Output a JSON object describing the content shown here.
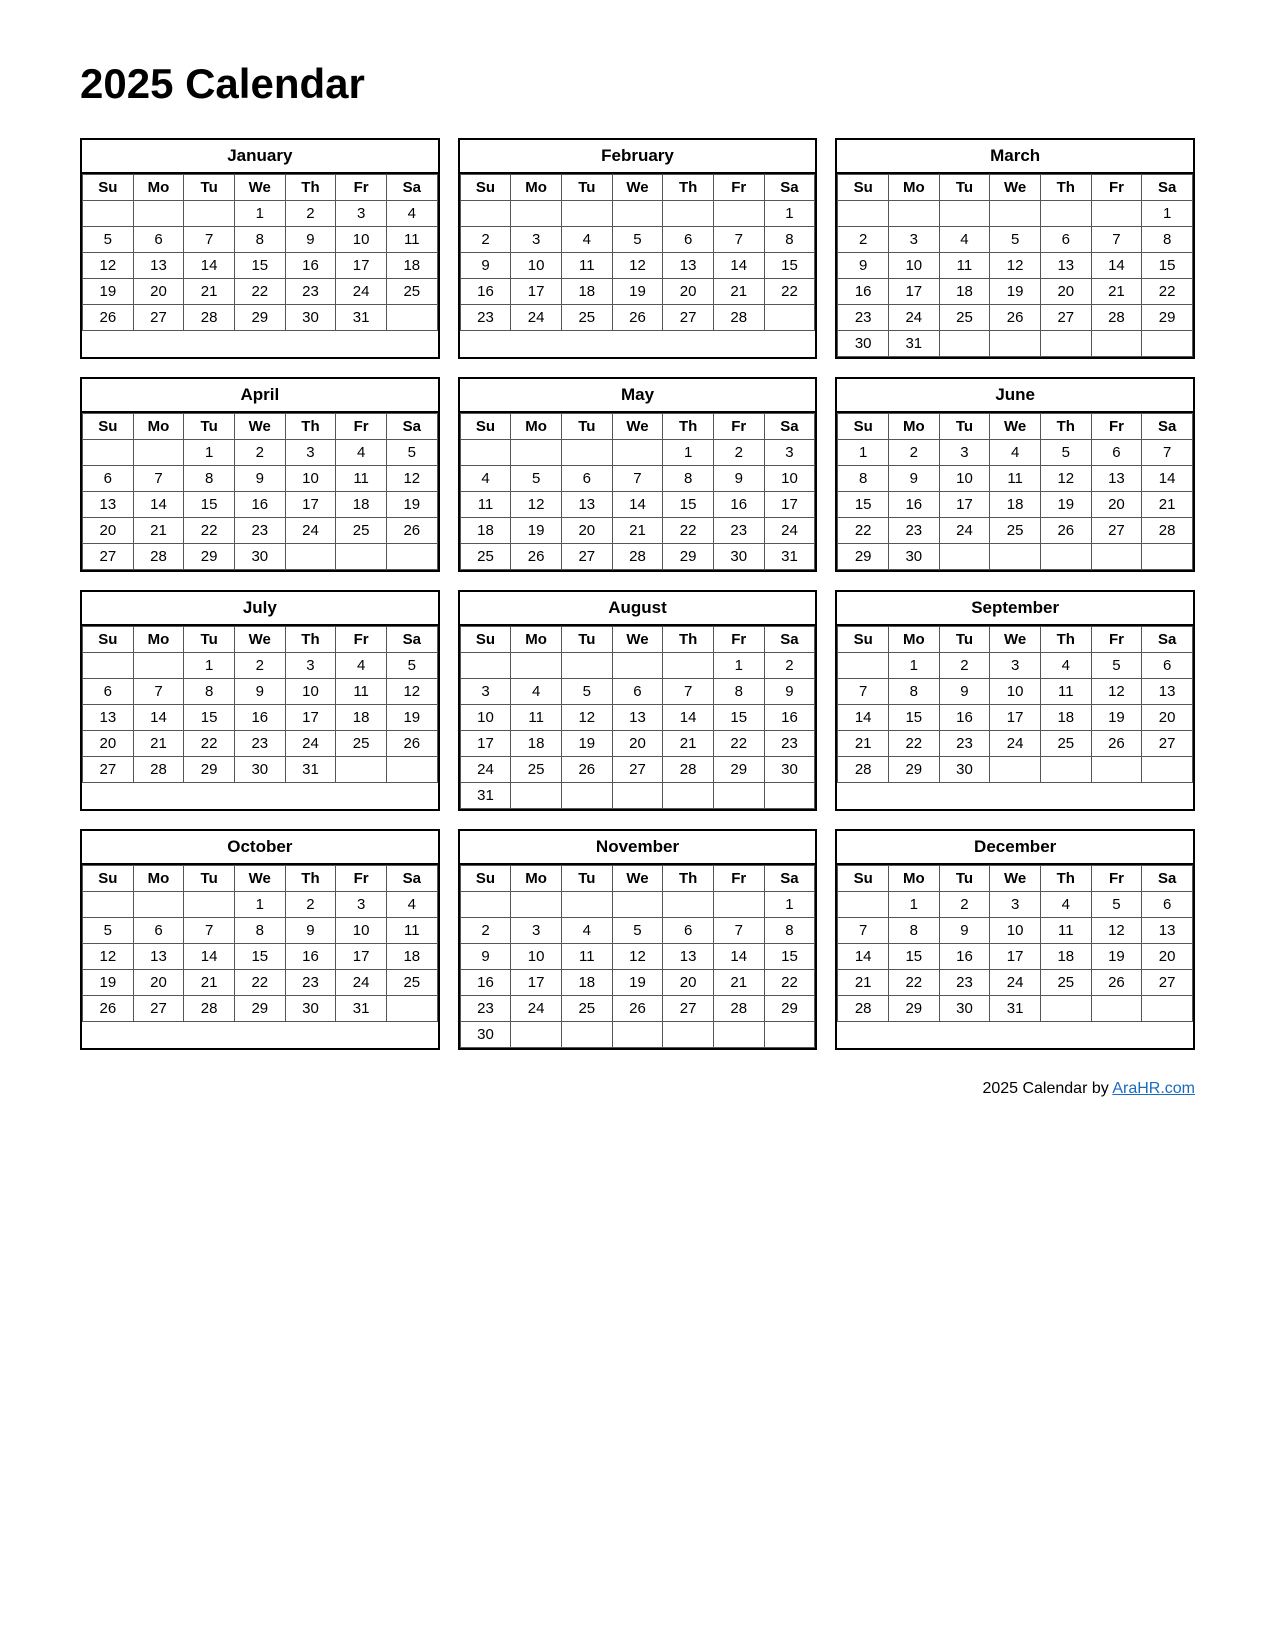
{
  "title": "2025 Calendar",
  "footer": {
    "text": "2025  Calendar by ",
    "link_text": "AraHR.com",
    "link_url": "#"
  },
  "months": [
    {
      "name": "January",
      "days_header": [
        "Su",
        "Mo",
        "Tu",
        "We",
        "Th",
        "Fr",
        "Sa"
      ],
      "weeks": [
        [
          "",
          "",
          "",
          "1",
          "2",
          "3",
          "4"
        ],
        [
          "5",
          "6",
          "7",
          "8",
          "9",
          "10",
          "11"
        ],
        [
          "12",
          "13",
          "14",
          "15",
          "16",
          "17",
          "18"
        ],
        [
          "19",
          "20",
          "21",
          "22",
          "23",
          "24",
          "25"
        ],
        [
          "26",
          "27",
          "28",
          "29",
          "30",
          "31",
          ""
        ]
      ]
    },
    {
      "name": "February",
      "days_header": [
        "Su",
        "Mo",
        "Tu",
        "We",
        "Th",
        "Fr",
        "Sa"
      ],
      "weeks": [
        [
          "",
          "",
          "",
          "",
          "",
          "",
          "1"
        ],
        [
          "2",
          "3",
          "4",
          "5",
          "6",
          "7",
          "8"
        ],
        [
          "9",
          "10",
          "11",
          "12",
          "13",
          "14",
          "15"
        ],
        [
          "16",
          "17",
          "18",
          "19",
          "20",
          "21",
          "22"
        ],
        [
          "23",
          "24",
          "25",
          "26",
          "27",
          "28",
          ""
        ]
      ]
    },
    {
      "name": "March",
      "days_header": [
        "Su",
        "Mo",
        "Tu",
        "We",
        "Th",
        "Fr",
        "Sa"
      ],
      "weeks": [
        [
          "",
          "",
          "",
          "",
          "",
          "",
          "1"
        ],
        [
          "2",
          "3",
          "4",
          "5",
          "6",
          "7",
          "8"
        ],
        [
          "9",
          "10",
          "11",
          "12",
          "13",
          "14",
          "15"
        ],
        [
          "16",
          "17",
          "18",
          "19",
          "20",
          "21",
          "22"
        ],
        [
          "23",
          "24",
          "25",
          "26",
          "27",
          "28",
          "29"
        ],
        [
          "30",
          "31",
          "",
          "",
          "",
          "",
          ""
        ]
      ]
    },
    {
      "name": "April",
      "days_header": [
        "Su",
        "Mo",
        "Tu",
        "We",
        "Th",
        "Fr",
        "Sa"
      ],
      "weeks": [
        [
          "",
          "",
          "1",
          "2",
          "3",
          "4",
          "5"
        ],
        [
          "6",
          "7",
          "8",
          "9",
          "10",
          "11",
          "12"
        ],
        [
          "13",
          "14",
          "15",
          "16",
          "17",
          "18",
          "19"
        ],
        [
          "20",
          "21",
          "22",
          "23",
          "24",
          "25",
          "26"
        ],
        [
          "27",
          "28",
          "29",
          "30",
          "",
          "",
          ""
        ]
      ]
    },
    {
      "name": "May",
      "days_header": [
        "Su",
        "Mo",
        "Tu",
        "We",
        "Th",
        "Fr",
        "Sa"
      ],
      "weeks": [
        [
          "",
          "",
          "",
          "",
          "1",
          "2",
          "3"
        ],
        [
          "4",
          "5",
          "6",
          "7",
          "8",
          "9",
          "10"
        ],
        [
          "11",
          "12",
          "13",
          "14",
          "15",
          "16",
          "17"
        ],
        [
          "18",
          "19",
          "20",
          "21",
          "22",
          "23",
          "24"
        ],
        [
          "25",
          "26",
          "27",
          "28",
          "29",
          "30",
          "31"
        ]
      ]
    },
    {
      "name": "June",
      "days_header": [
        "Su",
        "Mo",
        "Tu",
        "We",
        "Th",
        "Fr",
        "Sa"
      ],
      "weeks": [
        [
          "1",
          "2",
          "3",
          "4",
          "5",
          "6",
          "7"
        ],
        [
          "8",
          "9",
          "10",
          "11",
          "12",
          "13",
          "14"
        ],
        [
          "15",
          "16",
          "17",
          "18",
          "19",
          "20",
          "21"
        ],
        [
          "22",
          "23",
          "24",
          "25",
          "26",
          "27",
          "28"
        ],
        [
          "29",
          "30",
          "",
          "",
          "",
          "",
          ""
        ]
      ]
    },
    {
      "name": "July",
      "days_header": [
        "Su",
        "Mo",
        "Tu",
        "We",
        "Th",
        "Fr",
        "Sa"
      ],
      "weeks": [
        [
          "",
          "",
          "1",
          "2",
          "3",
          "4",
          "5"
        ],
        [
          "6",
          "7",
          "8",
          "9",
          "10",
          "11",
          "12"
        ],
        [
          "13",
          "14",
          "15",
          "16",
          "17",
          "18",
          "19"
        ],
        [
          "20",
          "21",
          "22",
          "23",
          "24",
          "25",
          "26"
        ],
        [
          "27",
          "28",
          "29",
          "30",
          "31",
          "",
          ""
        ]
      ]
    },
    {
      "name": "August",
      "days_header": [
        "Su",
        "Mo",
        "Tu",
        "We",
        "Th",
        "Fr",
        "Sa"
      ],
      "weeks": [
        [
          "",
          "",
          "",
          "",
          "",
          "1",
          "2"
        ],
        [
          "3",
          "4",
          "5",
          "6",
          "7",
          "8",
          "9"
        ],
        [
          "10",
          "11",
          "12",
          "13",
          "14",
          "15",
          "16"
        ],
        [
          "17",
          "18",
          "19",
          "20",
          "21",
          "22",
          "23"
        ],
        [
          "24",
          "25",
          "26",
          "27",
          "28",
          "29",
          "30"
        ],
        [
          "31",
          "",
          "",
          "",
          "",
          "",
          ""
        ]
      ]
    },
    {
      "name": "September",
      "days_header": [
        "Su",
        "Mo",
        "Tu",
        "We",
        "Th",
        "Fr",
        "Sa"
      ],
      "weeks": [
        [
          "",
          "1",
          "2",
          "3",
          "4",
          "5",
          "6"
        ],
        [
          "7",
          "8",
          "9",
          "10",
          "11",
          "12",
          "13"
        ],
        [
          "14",
          "15",
          "16",
          "17",
          "18",
          "19",
          "20"
        ],
        [
          "21",
          "22",
          "23",
          "24",
          "25",
          "26",
          "27"
        ],
        [
          "28",
          "29",
          "30",
          "",
          "",
          "",
          ""
        ]
      ]
    },
    {
      "name": "October",
      "days_header": [
        "Su",
        "Mo",
        "Tu",
        "We",
        "Th",
        "Fr",
        "Sa"
      ],
      "weeks": [
        [
          "",
          "",
          "",
          "1",
          "2",
          "3",
          "4"
        ],
        [
          "5",
          "6",
          "7",
          "8",
          "9",
          "10",
          "11"
        ],
        [
          "12",
          "13",
          "14",
          "15",
          "16",
          "17",
          "18"
        ],
        [
          "19",
          "20",
          "21",
          "22",
          "23",
          "24",
          "25"
        ],
        [
          "26",
          "27",
          "28",
          "29",
          "30",
          "31",
          ""
        ]
      ]
    },
    {
      "name": "November",
      "days_header": [
        "Su",
        "Mo",
        "Tu",
        "We",
        "Th",
        "Fr",
        "Sa"
      ],
      "weeks": [
        [
          "",
          "",
          "",
          "",
          "",
          "",
          "1"
        ],
        [
          "2",
          "3",
          "4",
          "5",
          "6",
          "7",
          "8"
        ],
        [
          "9",
          "10",
          "11",
          "12",
          "13",
          "14",
          "15"
        ],
        [
          "16",
          "17",
          "18",
          "19",
          "20",
          "21",
          "22"
        ],
        [
          "23",
          "24",
          "25",
          "26",
          "27",
          "28",
          "29"
        ],
        [
          "30",
          "",
          "",
          "",
          "",
          "",
          ""
        ]
      ]
    },
    {
      "name": "December",
      "days_header": [
        "Su",
        "Mo",
        "Tu",
        "We",
        "Th",
        "Fr",
        "Sa"
      ],
      "weeks": [
        [
          "",
          "1",
          "2",
          "3",
          "4",
          "5",
          "6"
        ],
        [
          "7",
          "8",
          "9",
          "10",
          "11",
          "12",
          "13"
        ],
        [
          "14",
          "15",
          "16",
          "17",
          "18",
          "19",
          "20"
        ],
        [
          "21",
          "22",
          "23",
          "24",
          "25",
          "26",
          "27"
        ],
        [
          "28",
          "29",
          "30",
          "31",
          "",
          "",
          ""
        ]
      ]
    }
  ]
}
